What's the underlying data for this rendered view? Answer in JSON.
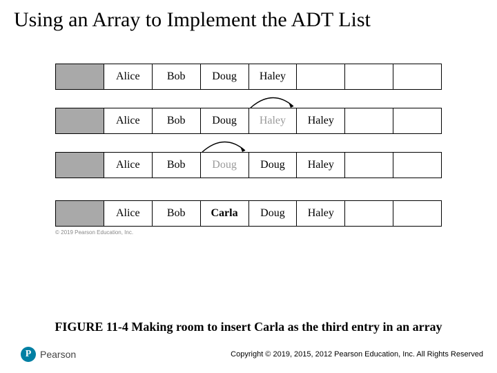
{
  "title": "Using an Array to Implement the ADT List",
  "rows": [
    {
      "cells": [
        "",
        "Alice",
        "Bob",
        "Doug",
        "Haley",
        "",
        "",
        ""
      ],
      "shaded": [
        0
      ],
      "faded": []
    },
    {
      "cells": [
        "",
        "Alice",
        "Bob",
        "Doug",
        "Haley",
        "Haley",
        "",
        ""
      ],
      "shaded": [
        0
      ],
      "faded": [
        4
      ]
    },
    {
      "cells": [
        "",
        "Alice",
        "Bob",
        "Doug",
        "Doug",
        "Haley",
        "",
        ""
      ],
      "shaded": [
        0
      ],
      "faded": [
        3
      ]
    },
    {
      "cells": [
        "",
        "Alice",
        "Bob",
        "Carla",
        "Doug",
        "Haley",
        "",
        ""
      ],
      "shaded": [
        0
      ],
      "faded": [],
      "bold": [
        3
      ]
    }
  ],
  "image_credit": "© 2019 Pearson Education, Inc.",
  "caption": "FIGURE 11-4 Making room to insert Carla as the third entry in an array",
  "logo_letter": "P",
  "logo_text": "Pearson",
  "copyright": "Copyright © 2019, 2015, 2012 Pearson Education, Inc. All Rights Reserved"
}
